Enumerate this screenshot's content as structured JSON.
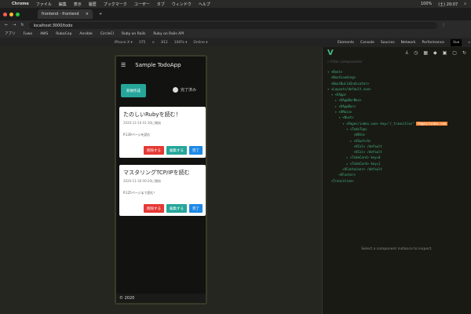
{
  "menubar": {
    "items": [
      "Chrome",
      "ファイル",
      "編集",
      "表示",
      "履歴",
      "ブックマーク",
      "ユーザー",
      "タブ",
      "ウィンドウ",
      "ヘルプ"
    ],
    "battery": "100%",
    "time": "(土) 20:07"
  },
  "tab": {
    "title": "frontend - frontend",
    "close": "×",
    "new": "+"
  },
  "address": {
    "url": "localhost:3000/todo"
  },
  "bookmarks": [
    "アプリ",
    "Fuwo",
    "AWS",
    "RuboCop",
    "Ansible",
    "CircleCI",
    "Ruby on Rails",
    "Ruby on Rails API"
  ],
  "device_bar": {
    "device": "iPhone X ▾",
    "width": "375",
    "x": "×",
    "height": "812",
    "zoom": "100% ▾",
    "network": "Online ▾"
  },
  "devtools_tabs": [
    "Elements",
    "Console",
    "Sources",
    "Network",
    "Performance",
    "Vue",
    "»"
  ],
  "app": {
    "title": "Sample TodoApp",
    "menu_icon": "☰",
    "new_button": "新規作成",
    "switch_label": "完了済み",
    "footer": "© 2020",
    "cards": [
      {
        "title": "たのしいRubyを読む！",
        "date": "2020-12-10 01:30に開始",
        "memo": "P.139ページを読む",
        "delete": "削除する",
        "edit": "編集する",
        "done": "完了"
      },
      {
        "title": "マスタリングTCP/IPを読む",
        "date": "2020-11-30 00:20に開始",
        "memo": "P.125ページまで読む！",
        "delete": "削除する",
        "edit": "編集する",
        "done": "完了"
      }
    ]
  },
  "vue": {
    "filter_placeholder": "Filter components",
    "hint": "Select a component instance to inspect.",
    "tree": [
      "▾ <Root>",
      "  <NuxtLoading>",
      "  <NuxtBuildIndicator>",
      "▾ <Layouts/default.vue>",
      "  ▾ <VApp>",
      "    ▸ <VAppBarNav>",
      "    ▸ <VAppBar>",
      "    ▾ <VMain>",
      "      ▾ <Nuxt>",
      "        ▾ <Pages/index.vue> key=\"/_transition\"",
      "          ▾ <TodoTop>",
      "              <VBtn>",
      "            ▸ <VSwitch>",
      "              <VCol> /default",
      "              <VCol> /default",
      "          ▸ <TodoCard> key=0",
      "          ▸ <TodoCard> key=1",
      "        <VContainer> /default",
      "      <VFooter>",
      "  <Transition>"
    ],
    "selected_badge": "Pages/index.vue",
    "selected_index": 9
  }
}
